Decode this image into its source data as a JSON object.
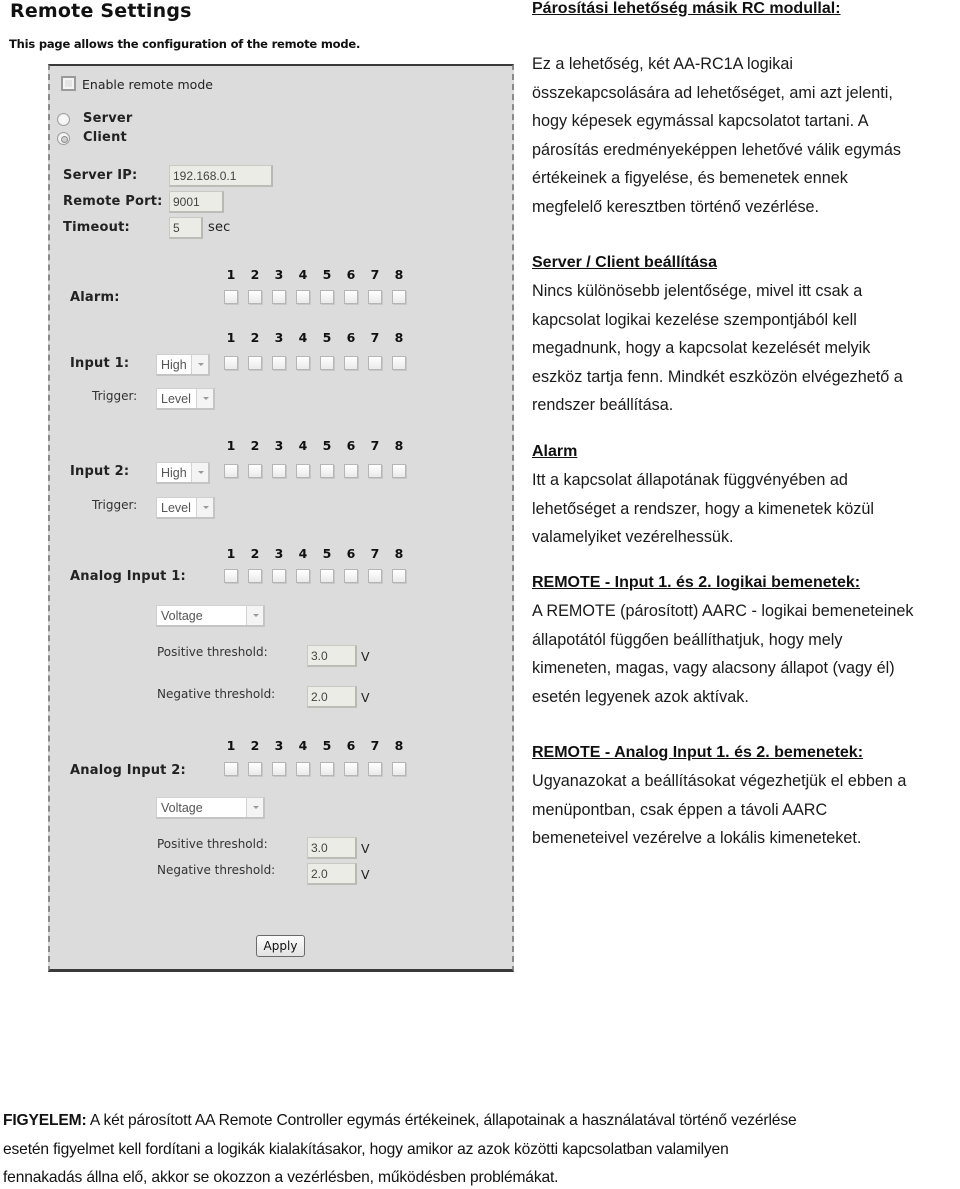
{
  "ui": {
    "title": "Remote Settings",
    "subtitle": "This page allows the configuration of the remote mode.",
    "enable_remote_mode": {
      "label": "Enable remote mode",
      "checked": false
    },
    "mode": {
      "options": [
        {
          "label": "Server",
          "checked": false
        },
        {
          "label": "Client",
          "checked": true
        }
      ]
    },
    "server_ip": {
      "label": "Server IP:",
      "value": "192.168.0.1"
    },
    "remote_port": {
      "label": "Remote Port:",
      "value": "9001"
    },
    "timeout": {
      "label": "Timeout:",
      "value": "5",
      "unit": "sec"
    },
    "channel_numbers": [
      "1",
      "2",
      "3",
      "4",
      "5",
      "6",
      "7",
      "8"
    ],
    "alarm": {
      "label": "Alarm:",
      "outputs_checked": [
        false,
        false,
        false,
        false,
        false,
        false,
        false,
        false
      ]
    },
    "input1": {
      "label": "Input 1:",
      "level_select": "High",
      "trigger_label": "Trigger:",
      "trigger_select": "Level",
      "outputs_checked": [
        false,
        false,
        false,
        false,
        false,
        false,
        false,
        false
      ]
    },
    "input2": {
      "label": "Input 2:",
      "level_select": "High",
      "trigger_label": "Trigger:",
      "trigger_select": "Level",
      "outputs_checked": [
        false,
        false,
        false,
        false,
        false,
        false,
        false,
        false
      ]
    },
    "analog1": {
      "label": "Analog Input 1:",
      "type_select": "Voltage",
      "positive_label": "Positive threshold:",
      "positive_value": "3.0",
      "negative_label": "Negative threshold:",
      "negative_value": "2.0",
      "unit": "V",
      "outputs_checked": [
        false,
        false,
        false,
        false,
        false,
        false,
        false,
        false
      ]
    },
    "analog2": {
      "label": "Analog Input 2:",
      "type_select": "Voltage",
      "positive_label": "Positive threshold:",
      "positive_value": "3.0",
      "negative_label": "Negative threshold:",
      "negative_value": "2.0",
      "unit": "V",
      "outputs_checked": [
        false,
        false,
        false,
        false,
        false,
        false,
        false,
        false
      ]
    },
    "apply_label": "Apply"
  },
  "doc": {
    "sections": [
      {
        "heading": "Párosítási lehetőség másik RC modullal:",
        "lines": [
          "Ez a lehetőség, két AA-RC1A logikai",
          "összekapcsolására ad lehetőséget, ami azt jelenti,",
          "hogy képesek egymással kapcsolatot tartani. A",
          "párosítás eredményeképpen lehetővé válik egymás",
          "értékeinek a figyelése, és bemenetek ennek",
          "megfelelő keresztben történő vezérlése."
        ]
      },
      {
        "heading": "Server / Client beállítása",
        "lines": [
          "Nincs különösebb jelentősége, mivel itt csak a",
          "kapcsolat logikai kezelése szempontjából kell",
          "megadnunk, hogy a kapcsolat kezelését melyik",
          "eszköz tartja fenn. Mindkét eszközön elvégezhető a",
          "rendszer beállítása."
        ]
      },
      {
        "heading": "Alarm",
        "lines": [
          "Itt a kapcsolat állapotának függvényében ad",
          "lehetőséget a rendszer, hogy a kimenetek közül",
          "valamelyiket vezérelhessük."
        ]
      },
      {
        "heading": "REMOTE - Input 1. és 2. logikai bemenetek:",
        "lines": [
          "A REMOTE (párosított) AARC - logikai bemeneteinek",
          "állapotától függően beállíthatjuk, hogy mely",
          "kimeneten, magas, vagy alacsony állapot (vagy él)",
          "esetén legyenek azok aktívak."
        ]
      },
      {
        "heading": "REMOTE - Analog Input 1. és 2. bemenetek:",
        "lines": [
          "Ugyanazokat a beállításokat végezhetjük el ebben a",
          "menüpontban, csak éppen a távoli AARC",
          "bemeneteivel vezérelve a lokális kimeneteket."
        ]
      }
    ],
    "warning": {
      "label": "FIGYELEM:",
      "lines": [
        " A két párosított AA Remote Controller egymás értékeinek, állapotainak a használatával történő vezérlése",
        "esetén figyelmet kell fordítani a logikák kialakításakor, hogy amikor az azok közötti kapcsolatban valamilyen",
        "fennakadás állna elő, akkor se okozzon a vezérlésben, működésben problémákat."
      ]
    }
  }
}
